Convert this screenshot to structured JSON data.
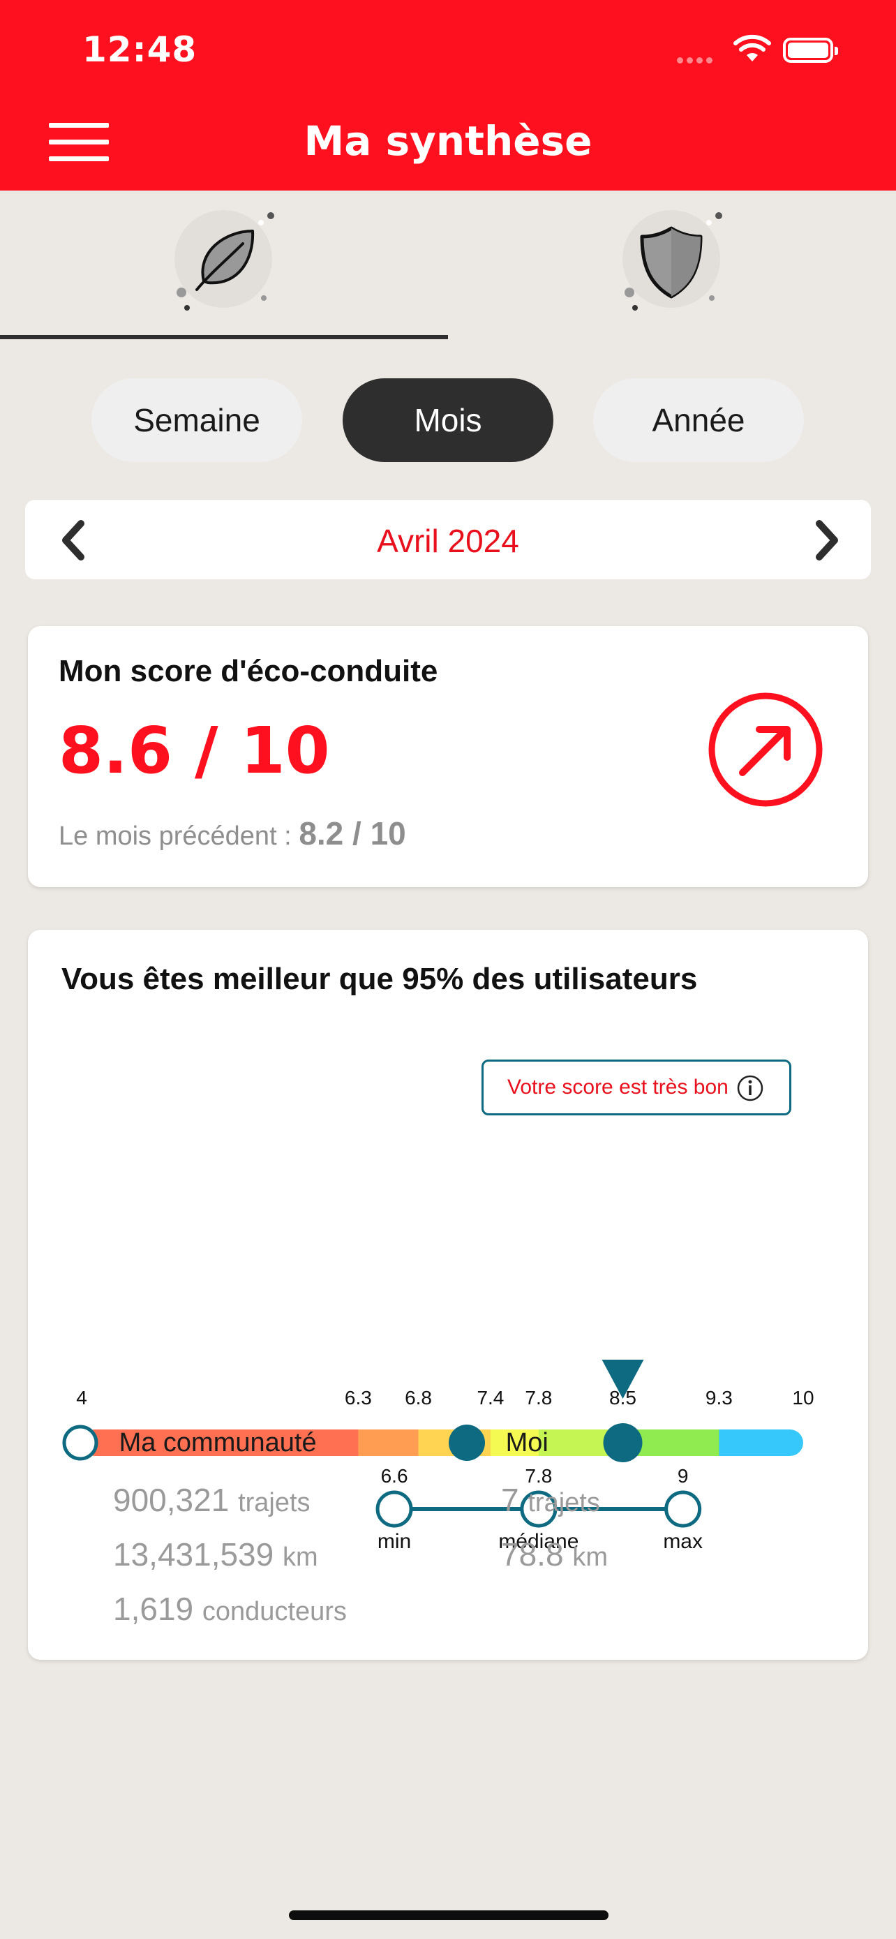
{
  "status": {
    "time": "12:48"
  },
  "header": {
    "title": "Ma synthèse"
  },
  "period": {
    "tabs": [
      "Semaine",
      "Mois",
      "Année"
    ],
    "selected": "Mois"
  },
  "month_nav": {
    "label": "Avril 2024"
  },
  "score_card": {
    "title": "Mon score d'éco-conduite",
    "score": "8.6 / 10",
    "previous_label": "Le mois précédent :",
    "previous_value": "8.2 / 10"
  },
  "community_card": {
    "title": "Vous êtes meilleur que 95% des utilisateurs",
    "badge": "Votre score est très bon",
    "gauge": {
      "min": 4,
      "max": 10,
      "user_score": 8.5,
      "tick_labels": [
        "4",
        "6.3",
        "6.8",
        "7.4",
        "7.8",
        "8.5",
        "9.3",
        "10"
      ],
      "segments": [
        {
          "from": 4,
          "to": 6.3,
          "color": "#FF6F52"
        },
        {
          "from": 6.3,
          "to": 6.8,
          "color": "#FF9E52"
        },
        {
          "from": 6.8,
          "to": 7.4,
          "color": "#FFD452"
        },
        {
          "from": 7.4,
          "to": 7.8,
          "color": "#F5FA52"
        },
        {
          "from": 7.8,
          "to": 8.5,
          "color": "#C4F552"
        },
        {
          "from": 8.5,
          "to": 9.3,
          "color": "#8FEB4F"
        },
        {
          "from": 9.3,
          "to": 10,
          "color": "#36C8FA"
        }
      ],
      "range": {
        "points": [
          {
            "value": 6.6,
            "value_label": "6.6",
            "label": "min"
          },
          {
            "value": 7.8,
            "value_label": "7.8",
            "label": "médiane"
          },
          {
            "value": 9,
            "value_label": "9",
            "label": "max"
          }
        ]
      },
      "accent_color": "#0E6A80"
    },
    "legend": {
      "community": {
        "label": "Ma communauté",
        "stats": [
          {
            "value": "900,321",
            "unit": "trajets"
          },
          {
            "value": "13,431,539",
            "unit": "km"
          },
          {
            "value": "1,619",
            "unit": "conducteurs"
          }
        ]
      },
      "me": {
        "label": "Moi",
        "stats": [
          {
            "value": "7",
            "unit": "trajets"
          },
          {
            "value": "78.8",
            "unit": "km"
          }
        ]
      }
    }
  },
  "icons": {
    "menu": "hamburger-icon",
    "eco_tab": "leaf-icon",
    "safety_tab": "shield-icon",
    "prev": "chevron-left-icon",
    "next": "chevron-right-icon",
    "trend": "arrow-up-right-icon",
    "info": "info-icon"
  },
  "colors": {
    "brand": "#FF101E",
    "dark": "#2E2E2E",
    "background": "#ECE8E3"
  }
}
